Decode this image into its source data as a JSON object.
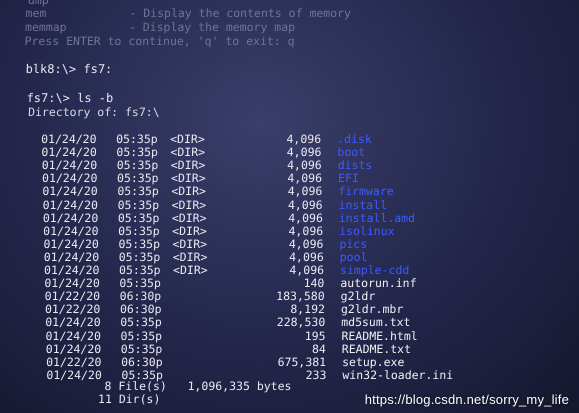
{
  "help_lines": [
    {
      "cmd": "mem",
      "desc": "- Display the contents of memory"
    },
    {
      "cmd": "memmap",
      "desc": "- Display the memory map"
    }
  ],
  "pager_hint": "Press ENTER to continue, 'q' to exit: q",
  "prompt1": "blk8:\\> fs7:",
  "prompt2": "fs7:\\> ls -b",
  "dir_header": "Directory of: fs7:\\",
  "entries": [
    {
      "date": "01/24/20",
      "time": "05:35p",
      "type": "<DIR>",
      "size": "4,096",
      "name": ".disk",
      "is_dir": true
    },
    {
      "date": "01/24/20",
      "time": "05:35p",
      "type": "<DIR>",
      "size": "4,096",
      "name": "boot",
      "is_dir": true
    },
    {
      "date": "01/24/20",
      "time": "05:35p",
      "type": "<DIR>",
      "size": "4,096",
      "name": "dists",
      "is_dir": true
    },
    {
      "date": "01/24/20",
      "time": "05:35p",
      "type": "<DIR>",
      "size": "4,096",
      "name": "EFI",
      "is_dir": true
    },
    {
      "date": "01/24/20",
      "time": "05:35p",
      "type": "<DIR>",
      "size": "4,096",
      "name": "firmware",
      "is_dir": true
    },
    {
      "date": "01/24/20",
      "time": "05:35p",
      "type": "<DIR>",
      "size": "4,096",
      "name": "install",
      "is_dir": true
    },
    {
      "date": "01/24/20",
      "time": "05:35p",
      "type": "<DIR>",
      "size": "4,096",
      "name": "install.amd",
      "is_dir": true
    },
    {
      "date": "01/24/20",
      "time": "05:35p",
      "type": "<DIR>",
      "size": "4,096",
      "name": "isolinux",
      "is_dir": true
    },
    {
      "date": "01/24/20",
      "time": "05:35p",
      "type": "<DIR>",
      "size": "4,096",
      "name": "pics",
      "is_dir": true
    },
    {
      "date": "01/24/20",
      "time": "05:35p",
      "type": "<DIR>",
      "size": "4,096",
      "name": "pool",
      "is_dir": true
    },
    {
      "date": "01/24/20",
      "time": "05:35p",
      "type": "<DIR>",
      "size": "4,096",
      "name": "simple-cdd",
      "is_dir": true
    },
    {
      "date": "01/24/20",
      "time": "05:35p",
      "type": "",
      "size": "140",
      "name": "autorun.inf",
      "is_dir": false
    },
    {
      "date": "01/22/20",
      "time": "06:30p",
      "type": "",
      "size": "183,580",
      "name": "g2ldr",
      "is_dir": false
    },
    {
      "date": "01/22/20",
      "time": "06:30p",
      "type": "",
      "size": "8,192",
      "name": "g2ldr.mbr",
      "is_dir": false
    },
    {
      "date": "01/24/20",
      "time": "05:35p",
      "type": "",
      "size": "228,530",
      "name": "md5sum.txt",
      "is_dir": false
    },
    {
      "date": "01/24/20",
      "time": "05:35p",
      "type": "",
      "size": "195",
      "name": "README.html",
      "is_dir": false
    },
    {
      "date": "01/24/20",
      "time": "05:35p",
      "type": "",
      "size": "84",
      "name": "README.txt",
      "is_dir": false
    },
    {
      "date": "01/22/20",
      "time": "06:30p",
      "type": "",
      "size": "675,381",
      "name": "setup.exe",
      "is_dir": false
    },
    {
      "date": "01/24/20",
      "time": "05:35p",
      "type": "",
      "size": "233",
      "name": "win32-loader.ini",
      "is_dir": false
    }
  ],
  "summary_files": "8 File(s)   1,096,335 bytes",
  "summary_dirs": "11 Dir(s)",
  "watermark": "https://blog.csdn.net/sorry_my_life",
  "colors": {
    "dir": "#3b5bff",
    "file": "#f2f0f6",
    "background": "#23264a"
  }
}
